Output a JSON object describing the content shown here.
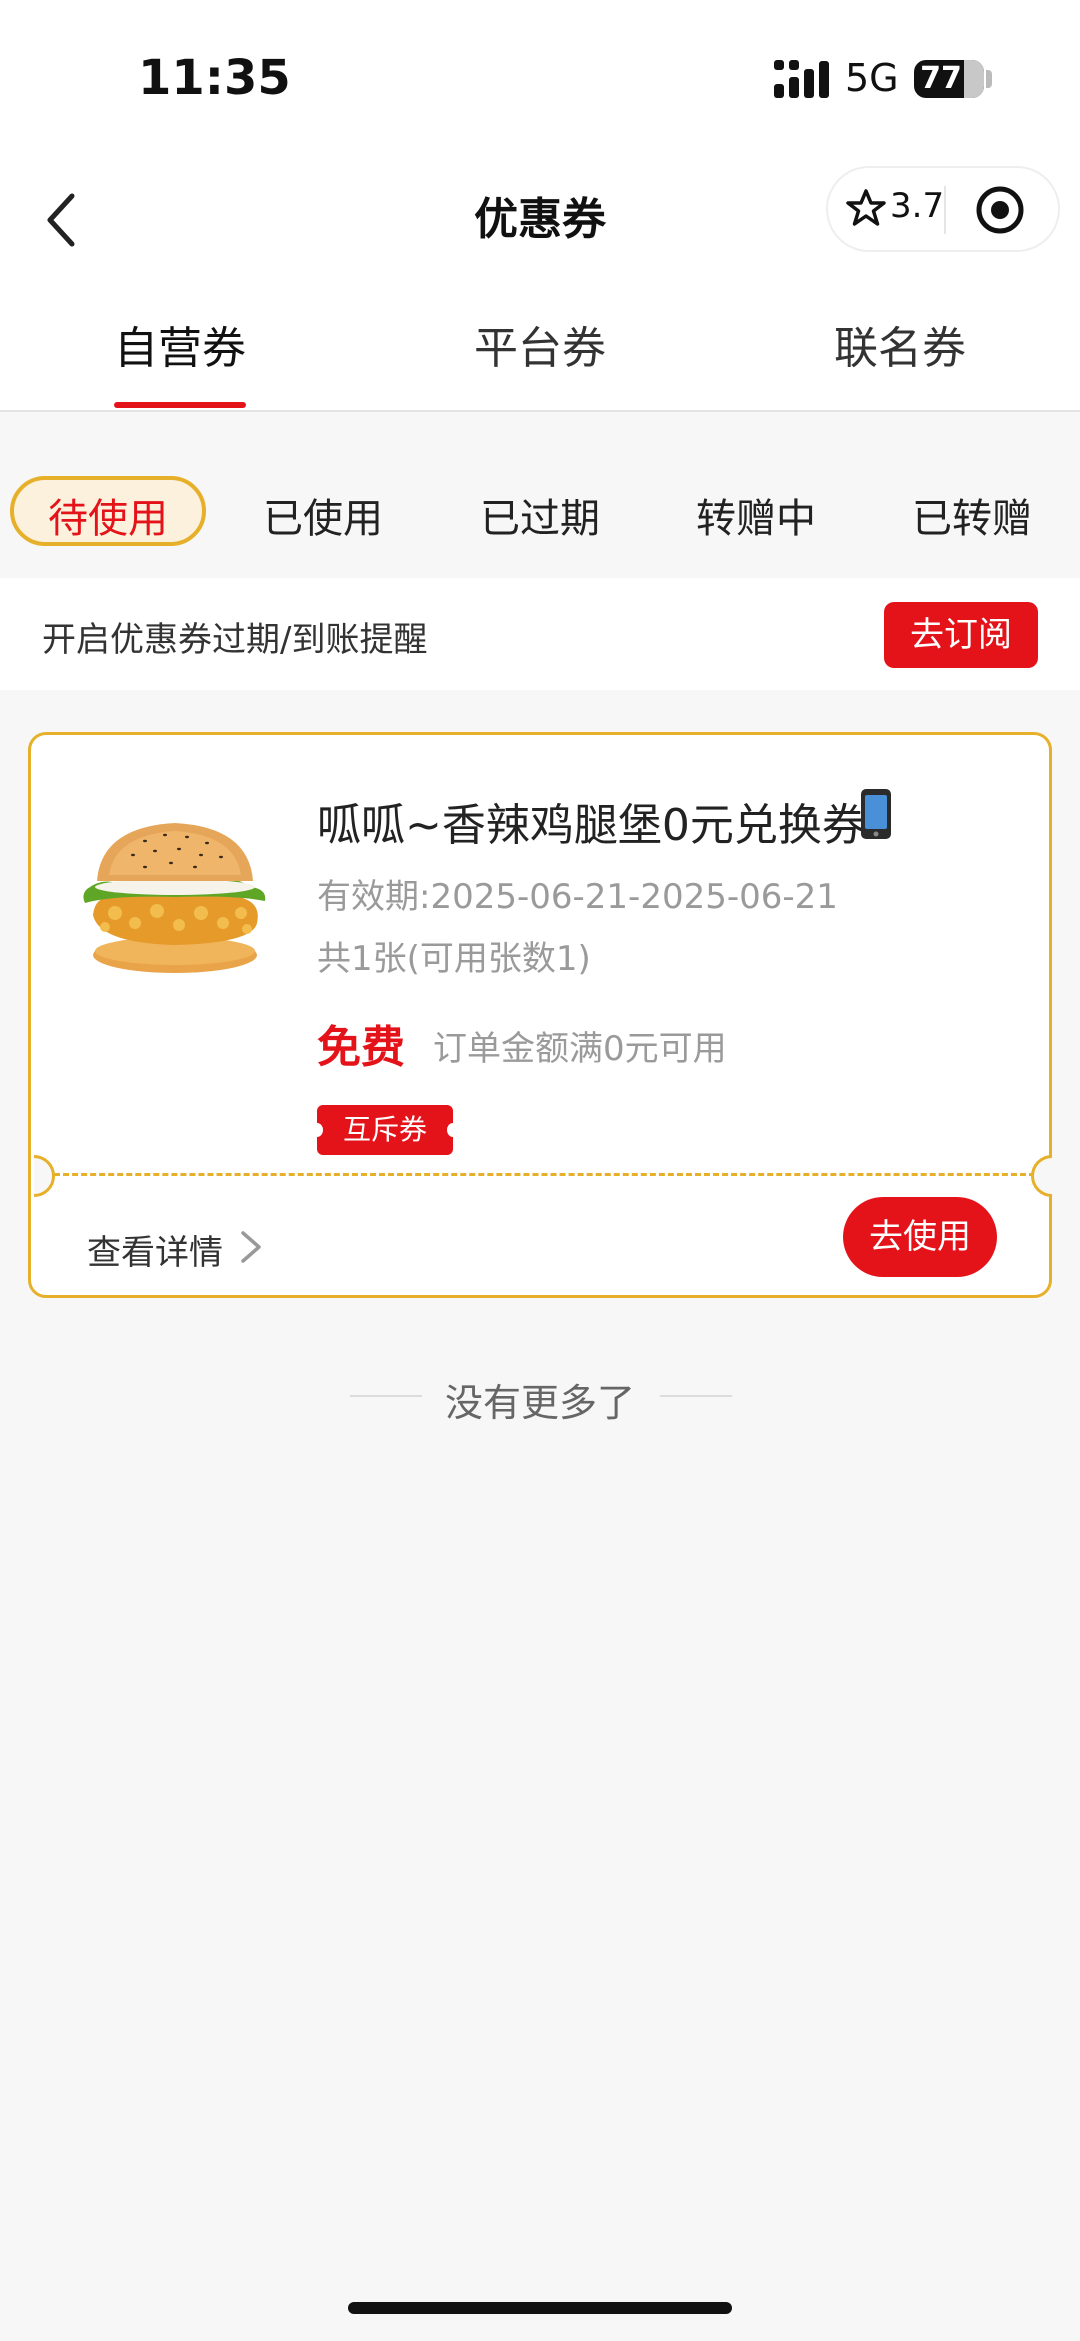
{
  "status_bar": {
    "time": "11:35",
    "network": "5G",
    "battery": "77"
  },
  "header": {
    "title": "优惠券",
    "rating": "3.7"
  },
  "tabs": [
    {
      "label": "自营券"
    },
    {
      "label": "平台券"
    },
    {
      "label": "联名券"
    }
  ],
  "active_tab": "自营券",
  "filters": [
    {
      "label": "待使用"
    },
    {
      "label": "已使用"
    },
    {
      "label": "已过期"
    },
    {
      "label": "转赠中"
    },
    {
      "label": "已转赠"
    }
  ],
  "subscribe": {
    "text": "开启优惠券过期/到账提醒",
    "button": "去订阅"
  },
  "coupon": {
    "title": "呱呱~香辣鸡腿堡0元兑换券",
    "validity": "有效期:2025-06-21-2025-06-21",
    "count": "共1张(可用张数1)",
    "price": "免费",
    "condition": "订单金额满0元可用",
    "tag": "互斥券",
    "details": "查看详情",
    "use_button": "去使用"
  },
  "end_text": "没有更多了",
  "colors": {
    "accent": "#e4131a",
    "border_gold": "#e6b02a",
    "background": "#f7f7f7"
  }
}
